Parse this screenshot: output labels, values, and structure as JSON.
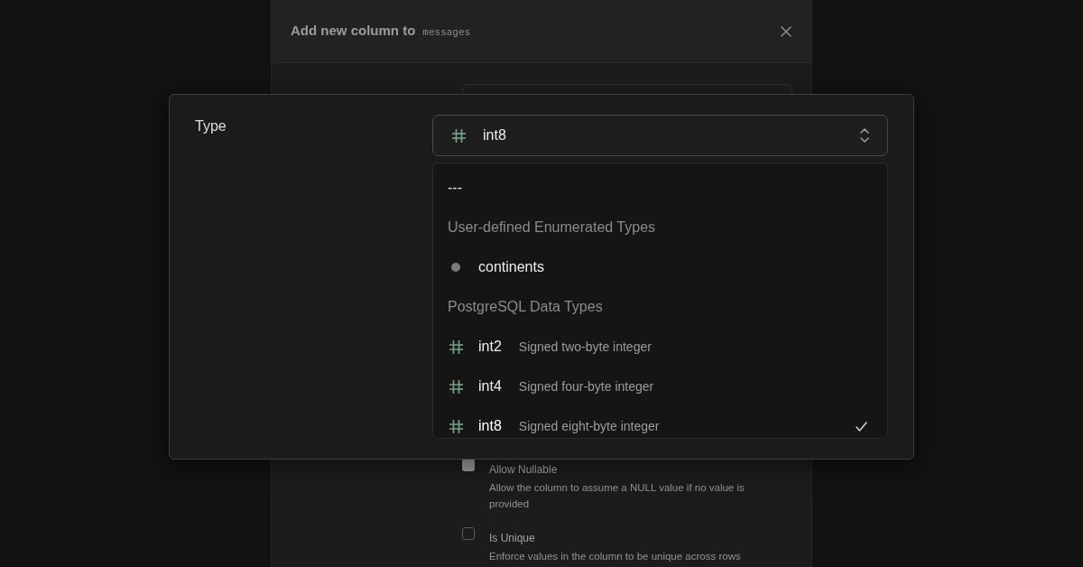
{
  "background_dialog": {
    "title": "Add new column to",
    "table_name": "messages",
    "options": [
      {
        "label": "Allow Nullable",
        "description": "Allow the column to assume a NULL value if no value is provided",
        "checked": true
      },
      {
        "label": "Is Unique",
        "description": "Enforce values in the column to be unique across rows",
        "checked": false
      }
    ]
  },
  "type_field": {
    "label": "Type",
    "value": "int8",
    "kind": "number"
  },
  "type_menu": {
    "none_option": {
      "label": "---",
      "selected": false
    },
    "groups": [
      {
        "heading": "User-defined Enumerated Types",
        "options": [
          {
            "kind": "enum",
            "label": "continents",
            "selected": false
          }
        ]
      },
      {
        "heading": "PostgreSQL Data Types",
        "options": [
          {
            "kind": "number",
            "label": "int2",
            "description": "Signed two-byte integer",
            "selected": false
          },
          {
            "kind": "number",
            "label": "int4",
            "description": "Signed four-byte integer",
            "selected": false
          },
          {
            "kind": "number",
            "label": "int8",
            "description": "Signed eight-byte integer",
            "selected": true
          }
        ]
      }
    ]
  }
}
